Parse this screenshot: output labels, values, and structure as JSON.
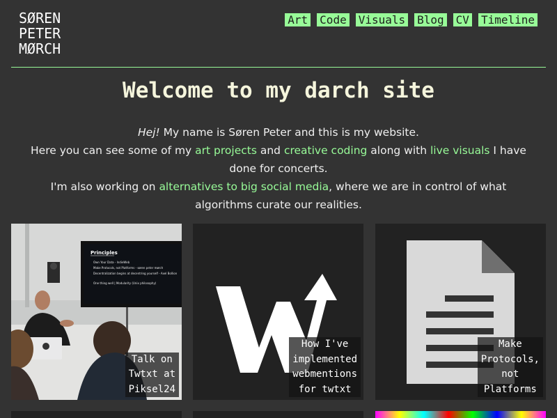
{
  "logo": {
    "lines": [
      "SØREN",
      "PETER",
      "MØRCH"
    ]
  },
  "nav": {
    "items": [
      "Art",
      "Code",
      "Visuals",
      "Blog",
      "CV",
      "Timeline"
    ]
  },
  "page_title": "Welcome to my darch site",
  "intro": {
    "greeting": "Hej!",
    "line1_rest": " My name is Søren Peter and this is my website.",
    "line2_a": "Here you can see some of my ",
    "link_art": "art projects",
    "line2_b": " and ",
    "link_code": "creative coding",
    "line2_c": " along with ",
    "link_visuals": "live visuals",
    "line2_d": " I have done for concerts.",
    "line3_a": "I'm also working on ",
    "link_social": "alternatives to big social media",
    "line3_b": ", where we are in control of what algorithms curate our realities."
  },
  "cards": [
    {
      "caption_lines": [
        "Talk on",
        "Twtxt at",
        "Piksel24"
      ],
      "slide_title": "Principles",
      "slide_bullets": [
        "Own Your Data - IndieWeb",
        "Make Protocols, not Platforms - søren peter mørch",
        "Decentralization begins at decentring yourself - Axel Bollion",
        "One thing well | Modularity (Unix philosophy)"
      ]
    },
    {
      "caption_lines": [
        "How I've",
        "implemented",
        "webmentions",
        "for twtxt"
      ],
      "logo_letter": "W"
    },
    {
      "caption_lines": [
        "Make",
        "Protocols,",
        "not",
        "Platforms"
      ]
    }
  ],
  "colors": {
    "accent": "#98fb98",
    "background": "#333333",
    "title": "#f5f5dc",
    "card": "#222222"
  },
  "icons": [
    "webmention-logo-icon",
    "document-icon"
  ]
}
